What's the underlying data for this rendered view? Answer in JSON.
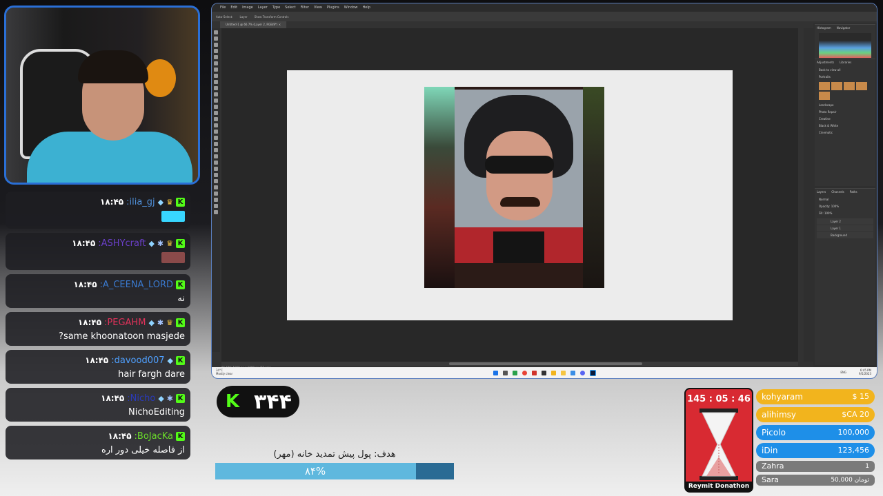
{
  "colors": {
    "accent_blue": "#2a6fd6",
    "kick_green": "#53fc18",
    "photoshop_bg": "#323232",
    "timer_red": "#d82a32",
    "gold": "#f2b41d",
    "blue": "#1e8fe8",
    "gray": "#7a7a7a"
  },
  "chat": {
    "messages": [
      {
        "time": "۱۸:۴۵",
        "user": ":ilia_gj",
        "user_color": "#4f8fd8",
        "badges": [
          "kick-icon",
          "crown-icon",
          "diamond-icon"
        ],
        "text": "",
        "emote_color": "#38d6ff"
      },
      {
        "time": "۱۸:۴۵",
        "user": ":ASHYcraft",
        "user_color": "#6a3fc8",
        "badges": [
          "kick-icon",
          "crown-icon",
          "gear-icon",
          "diamond-icon"
        ],
        "text": "",
        "emote_color": "#8a4a4a"
      },
      {
        "time": "۱۸:۴۵",
        "user": ":A_CEENA_LORD",
        "user_color": "#3a7ad0",
        "badges": [
          "kick-icon"
        ],
        "text": "نه",
        "emote_color": ""
      },
      {
        "time": "۱۸:۴۵",
        "user": ":PEGAHM",
        "user_color": "#e0325a",
        "badges": [
          "kick-icon",
          "crown-icon",
          "gear-icon",
          "diamond-icon"
        ],
        "text": "?same khoonatoon masjede",
        "emote_color": ""
      },
      {
        "time": "۱۸:۴۵",
        "user": ":davood007",
        "user_color": "#4fa0ff",
        "badges": [
          "kick-icon",
          "diamond-icon"
        ],
        "text": "hair fargh dare",
        "emote_color": ""
      },
      {
        "time": "۱۸:۴۵",
        "user": ":Nicho",
        "user_color": "#2a3ab8",
        "badges": [
          "kick-icon",
          "gear-icon",
          "diamond-icon"
        ],
        "text": "NichoEditing",
        "emote_color": ""
      },
      {
        "time": "۱۸:۴۵",
        "user": ":BoJacKa",
        "user_color": "#6adc2a",
        "badges": [
          "kick-icon"
        ],
        "text": "از فاصله خیلی دور اره",
        "emote_color": ""
      }
    ]
  },
  "photoshop": {
    "menu": [
      "File",
      "Edit",
      "Image",
      "Layer",
      "Type",
      "Select",
      "Filter",
      "View",
      "Plugins",
      "Window",
      "Help"
    ],
    "options": [
      "Auto-Select:",
      "Layer",
      "Show Transform Controls"
    ],
    "doc_tab": "Untitled-1 @ 66.7% (Layer 2, RGB/8*) ×",
    "status": "66.67%    1960 px x 1080 px (72 ppi)",
    "panels": {
      "histogram_tabs": [
        "Histogram",
        "Navigator"
      ],
      "adjust_tabs": [
        "Adjustments",
        "Libraries"
      ],
      "back_label": "Back to view all",
      "groups": [
        "Portraits",
        "Landscape",
        "Photo Repair",
        "Creative",
        "Black & White",
        "Cinematic"
      ],
      "layers_tabs": [
        "Layers",
        "Channels",
        "Paths"
      ],
      "blend_mode": "Normal",
      "opacity": "Opacity: 100%",
      "fill": "Fill: 100%",
      "layers": [
        "Layer 2",
        "Layer 1",
        "Background"
      ]
    }
  },
  "taskbar": {
    "weather_temp": "34°C",
    "weather_desc": "Mostly clear",
    "lang": "ENG",
    "time": "6:45 PM",
    "date": "9/5/2023"
  },
  "kick": {
    "count": "۳۴۴"
  },
  "goal": {
    "label": "هدف: پول پیش تمدید خانه (مهر)",
    "percent_text": "۸۴%",
    "percent": 84
  },
  "timer": {
    "time": "145 : 05 : 46",
    "label": "Reymit Donathon"
  },
  "leaderboard": [
    {
      "name": "kohyaram",
      "amount": "$ 15",
      "color": "#f2b41d"
    },
    {
      "name": "alihimsy",
      "amount": "$CA 20",
      "color": "#f2b41d"
    },
    {
      "name": "Picolo",
      "amount": "100,000",
      "color": "#1e8fe8"
    },
    {
      "name": "iDin",
      "amount": "123,456",
      "color": "#1e8fe8"
    },
    {
      "name": "Zahra",
      "amount": "1",
      "color": "#7a7a7a"
    },
    {
      "name": "Sara",
      "amount": "50,000 تومان",
      "color": "#7a7a7a"
    }
  ]
}
